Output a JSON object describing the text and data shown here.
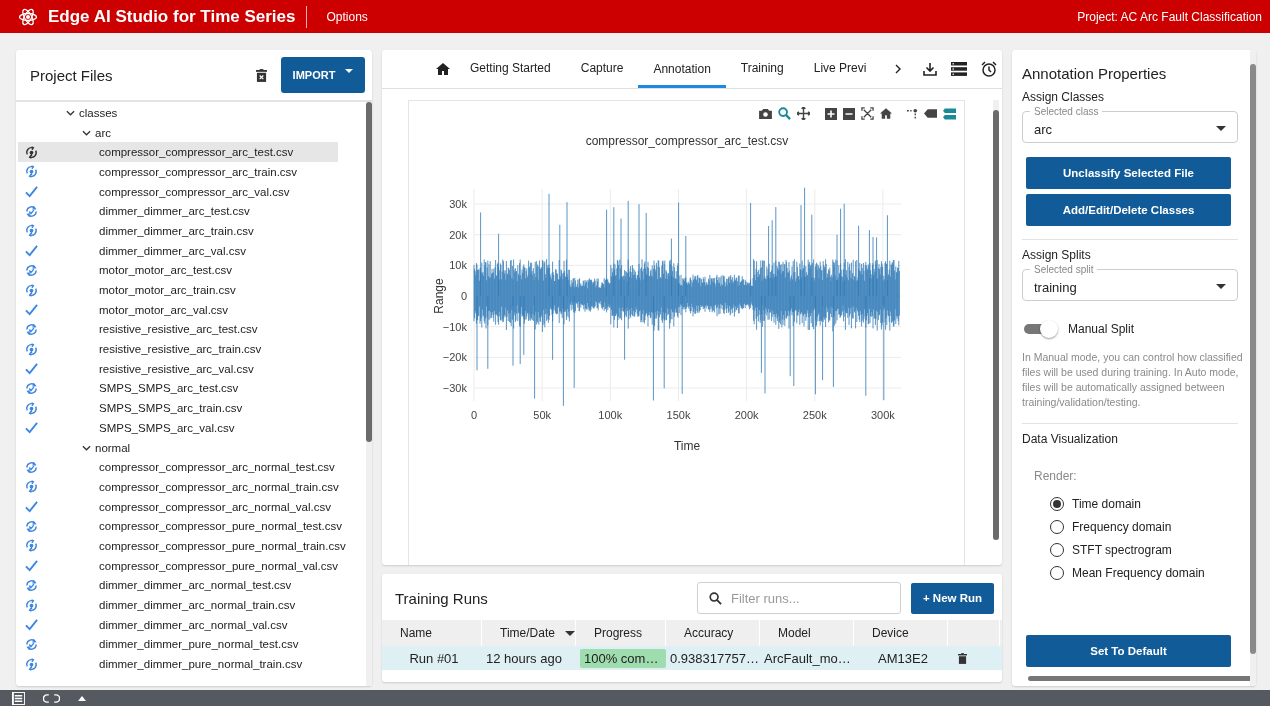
{
  "app_bar": {
    "title": "Edge AI Studio for Time Series",
    "menu": "Options",
    "project": "Project: AC Arc Fault Classification"
  },
  "project_files": {
    "title": "Project Files",
    "import_button": "IMPORT",
    "tree": [
      {
        "label": "classes",
        "expanded": true,
        "children": [
          {
            "label": "arc",
            "expanded": true,
            "children": [
              {
                "label": "compressor_compressor_arc_test.csv",
                "kind": "sync-dot",
                "selected": true
              },
              {
                "label": "compressor_compressor_arc_train.csv",
                "kind": "sync-dot",
                "selected": false
              },
              {
                "label": "compressor_compressor_arc_val.csv",
                "kind": "check",
                "selected": false
              },
              {
                "label": "dimmer_dimmer_arc_test.csv",
                "kind": "sync-check",
                "selected": false
              },
              {
                "label": "dimmer_dimmer_arc_train.csv",
                "kind": "sync-dot",
                "selected": false
              },
              {
                "label": "dimmer_dimmer_arc_val.csv",
                "kind": "check",
                "selected": false
              },
              {
                "label": "motor_motor_arc_test.csv",
                "kind": "sync-check",
                "selected": false
              },
              {
                "label": "motor_motor_arc_train.csv",
                "kind": "sync-dot",
                "selected": false
              },
              {
                "label": "motor_motor_arc_val.csv",
                "kind": "check",
                "selected": false
              },
              {
                "label": "resistive_resistive_arc_test.csv",
                "kind": "sync-check",
                "selected": false
              },
              {
                "label": "resistive_resistive_arc_train.csv",
                "kind": "sync-dot",
                "selected": false
              },
              {
                "label": "resistive_resistive_arc_val.csv",
                "kind": "check",
                "selected": false
              },
              {
                "label": "SMPS_SMPS_arc_test.csv",
                "kind": "sync-check",
                "selected": false
              },
              {
                "label": "SMPS_SMPS_arc_train.csv",
                "kind": "sync-dot",
                "selected": false
              },
              {
                "label": "SMPS_SMPS_arc_val.csv",
                "kind": "check",
                "selected": false
              }
            ]
          },
          {
            "label": "normal",
            "expanded": true,
            "children": [
              {
                "label": "compressor_compressor_arc_normal_test.csv",
                "kind": "sync-check",
                "selected": false
              },
              {
                "label": "compressor_compressor_arc_normal_train.csv",
                "kind": "sync-dot",
                "selected": false
              },
              {
                "label": "compressor_compressor_arc_normal_val.csv",
                "kind": "check",
                "selected": false
              },
              {
                "label": "compressor_compressor_pure_normal_test.csv",
                "kind": "sync-check",
                "selected": false
              },
              {
                "label": "compressor_compressor_pure_normal_train.csv",
                "kind": "sync-dot",
                "selected": false
              },
              {
                "label": "compressor_compressor_pure_normal_val.csv",
                "kind": "check",
                "selected": false
              },
              {
                "label": "dimmer_dimmer_arc_normal_test.csv",
                "kind": "sync-check",
                "selected": false
              },
              {
                "label": "dimmer_dimmer_arc_normal_train.csv",
                "kind": "sync-dot",
                "selected": false
              },
              {
                "label": "dimmer_dimmer_arc_normal_val.csv",
                "kind": "check",
                "selected": false
              },
              {
                "label": "dimmer_dimmer_pure_normal_test.csv",
                "kind": "sync-check",
                "selected": false
              },
              {
                "label": "dimmer_dimmer_pure_normal_train.csv",
                "kind": "sync-dot",
                "selected": false
              }
            ]
          }
        ]
      }
    ]
  },
  "tabs": [
    {
      "label": "Getting Started",
      "selected": false
    },
    {
      "label": "Capture",
      "selected": false
    },
    {
      "label": "Annotation",
      "selected": true
    },
    {
      "label": "Training",
      "selected": false
    },
    {
      "label": "Live Previ",
      "selected": false
    }
  ],
  "plot": {
    "title": "compressor_compressor_arc_test.csv",
    "xlabel": "Time",
    "ylabel": "Range",
    "yticks": [
      "30k",
      "20k",
      "10k",
      "0",
      "−10k",
      "−20k",
      "−30k"
    ],
    "xticks": [
      "0",
      "50k",
      "100k",
      "150k",
      "200k",
      "250k",
      "300k"
    ]
  },
  "training_runs": {
    "title": "Training Runs",
    "filter_placeholder": "Filter runs...",
    "new_run_button": "+ New Run",
    "columns": [
      {
        "label": "Name",
        "sorted": false
      },
      {
        "label": "Time/Date",
        "sorted": true
      },
      {
        "label": "Progress",
        "sorted": false
      },
      {
        "label": "Accuracy",
        "sorted": false
      },
      {
        "label": "Model",
        "sorted": false
      },
      {
        "label": "Device",
        "sorted": false
      }
    ],
    "rows": [
      {
        "selected": true,
        "name": "Run #01",
        "time": "12 hours ago",
        "progress": "100% com…",
        "level": 1,
        "accuracy": "0.938317757…",
        "model": "ArcFault_mo…",
        "device": "AM13E2"
      }
    ]
  },
  "annotation_properties": {
    "title": "Annotation Properties",
    "classes_heading": "Assign Classes",
    "class_select": {
      "label": "Selected class",
      "value": "arc"
    },
    "buttons": [
      "Unclassify Selected File",
      "Add/Edit/Delete Classes"
    ],
    "splits_heading": "Assign Splits",
    "split_select": {
      "label": "Selected split",
      "value": "training"
    },
    "manual_split": {
      "label": "Manual Split",
      "on": true
    },
    "description": "In Manual mode, you can control how classified files will be used during training. In Auto mode, files will be automatically assigned between training/validation/testing.",
    "visualization_heading": "Data Visualization",
    "render_label": "Render:",
    "render_options": [
      {
        "label": "Time domain",
        "selected": true
      },
      {
        "label": "Frequency domain",
        "selected": false
      },
      {
        "label": "STFT spectrogram",
        "selected": false
      },
      {
        "label": "Mean Frequency domain",
        "selected": false
      }
    ],
    "default_button": "Set To Default"
  }
}
